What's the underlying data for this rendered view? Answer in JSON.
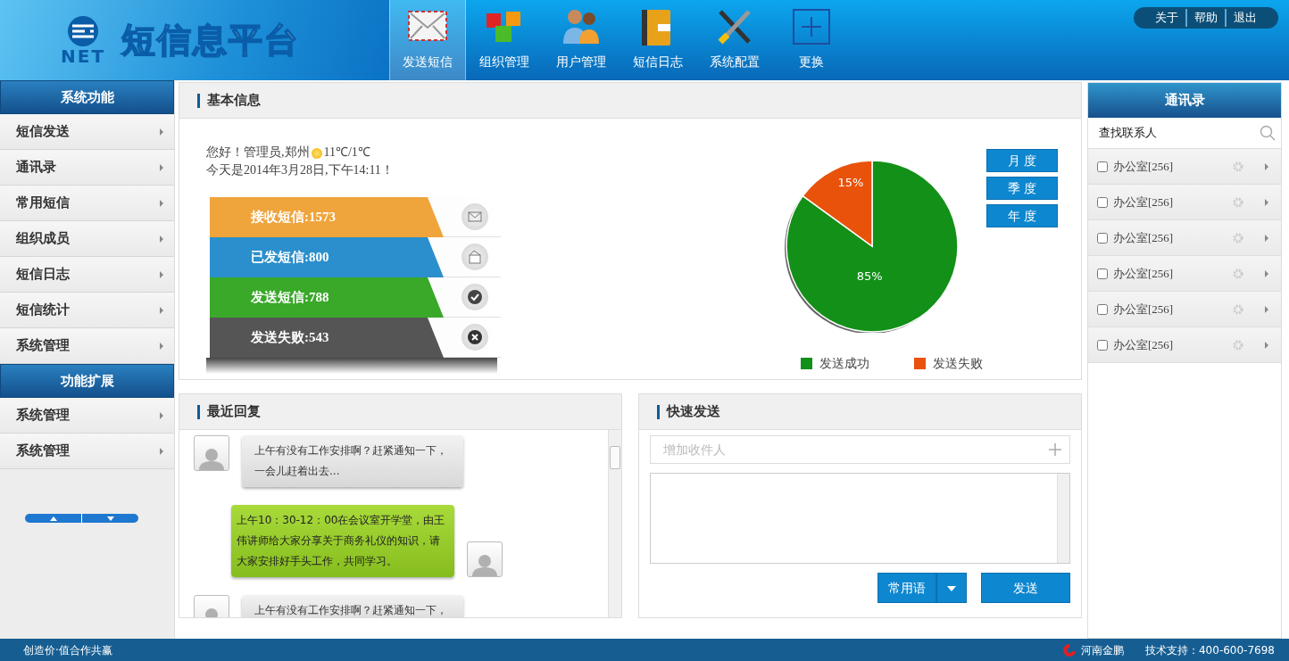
{
  "header": {
    "logo_mark": "NET",
    "title": "短信息平台",
    "nav": [
      {
        "label": "发送短信",
        "kind": "mail",
        "selected": true
      },
      {
        "label": "组织管理",
        "kind": "cubes",
        "selected": false
      },
      {
        "label": "用户管理",
        "kind": "users",
        "selected": false
      },
      {
        "label": "短信日志",
        "kind": "book",
        "selected": false
      },
      {
        "label": "系统配置",
        "kind": "tools",
        "selected": false
      },
      {
        "label": "更换",
        "kind": "plus",
        "selected": false
      }
    ],
    "links": [
      "关于",
      "帮助",
      "退出"
    ]
  },
  "sidebar": {
    "groups": [
      {
        "title": "系统功能",
        "items": [
          "短信发送",
          "通讯录",
          "常用短信",
          "组织成员",
          "短信日志",
          "短信统计",
          "系统管理"
        ]
      },
      {
        "title": "功能扩展",
        "items": [
          "系统管理",
          "系统管理"
        ]
      }
    ]
  },
  "basic_info": {
    "title": "基本信息",
    "greeting": "您好！管理员,郑州",
    "weather": "11℃/1℃",
    "date_line": "今天是2014年3月28日,下午14:11！",
    "stats": [
      {
        "kind": "received",
        "label": "接收短信:1573",
        "color": "#f0a43c"
      },
      {
        "kind": "sent",
        "label": "已发短信:800",
        "color": "#2a8fcc"
      },
      {
        "kind": "success",
        "label": "发送短信:788",
        "color": "#3aa829"
      },
      {
        "kind": "failed",
        "label": "发送失败:543",
        "color": "#555555"
      }
    ],
    "periods": [
      "月 度",
      "季 度",
      "年 度"
    ],
    "chart_data": {
      "type": "pie",
      "categories": [
        "发送成功",
        "发送失败"
      ],
      "series": [
        {
          "values": [
            85,
            15
          ]
        }
      ],
      "colors": [
        "#139018",
        "#e8520b"
      ],
      "value_labels": [
        "85%",
        "15%"
      ]
    }
  },
  "recent_replies": {
    "title": "最近回复",
    "messages": [
      {
        "kind": "incoming",
        "text": "上午有没有工作安排啊？赶紧通知一下，一会儿赶着出去..."
      },
      {
        "kind": "outgoing",
        "text": "上午10：30-12：00在会议室开学堂，由王伟讲师给大家分享关于商务礼仪的知识，请大家安排好手头工作，共同学习。"
      },
      {
        "kind": "incoming",
        "text": "上午有没有工作安排啊？赶紧通知一下，"
      }
    ]
  },
  "quick_send": {
    "title": "快速发送",
    "recipient": {
      "placeholder": "增加收件人"
    },
    "phrases_button": "常用语",
    "send_button": "发送"
  },
  "contacts": {
    "title": "通讯录",
    "search": {
      "placeholder": "查找联系人"
    },
    "items": [
      {
        "label": "办公室[256]",
        "checked": false
      },
      {
        "label": "办公室[256]",
        "checked": false
      },
      {
        "label": "办公室[256]",
        "checked": false
      },
      {
        "label": "办公室[256]",
        "checked": false
      },
      {
        "label": "办公室[256]",
        "checked": false
      },
      {
        "label": "办公室[256]",
        "checked": false
      }
    ]
  },
  "footer": {
    "slogan": "创造价·值合作共赢",
    "brand": "河南金鹏",
    "support": "技术支持：400-600-7698"
  }
}
